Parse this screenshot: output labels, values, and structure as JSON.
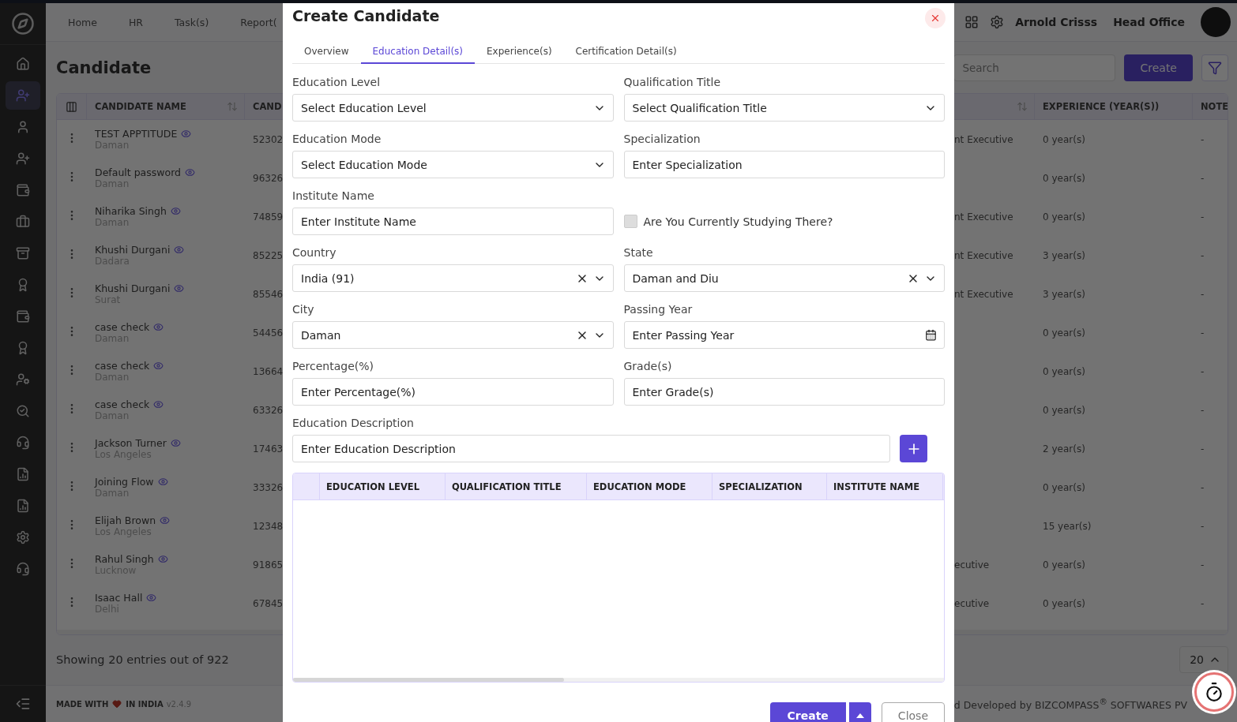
{
  "sidebar": {
    "items": [
      {
        "selected": false
      },
      {
        "selected": true
      },
      {
        "selected": false
      },
      {
        "selected": false
      },
      {
        "selected": false
      },
      {
        "selected": false
      },
      {
        "selected": false
      },
      {
        "selected": false
      },
      {
        "selected": false
      },
      {
        "selected": false
      },
      {
        "selected": false
      },
      {
        "selected": false
      },
      {
        "selected": false
      },
      {
        "selected": false
      },
      {
        "selected": false
      },
      {
        "selected": false
      },
      {
        "selected": false
      }
    ]
  },
  "top_nav": {
    "items": [
      "Home",
      "HR",
      "Task(s)",
      "Report("
    ],
    "user_name": "Arnold Crisss",
    "branch": "Head Office"
  },
  "page": {
    "title": "Candidate",
    "search": {
      "placeholder": "Search"
    },
    "create_button": "Create"
  },
  "table": {
    "columns": {
      "name": "CANDIDATE NAME",
      "column_2": "CAND",
      "experience": "EXPERIENCE (YEAR(S))",
      "note": "NOTE"
    },
    "rows": [
      {
        "name": "TEST APPTITUDE",
        "location": "Daman",
        "column_2": "52302",
        "column_4": "nt Executive",
        "experience": "0 year(s)",
        "note": "-"
      },
      {
        "name": "Default password",
        "location": "Daman",
        "column_2": "96326",
        "experience": "0 year(s)",
        "note": "-"
      },
      {
        "name": "Niharika Singh",
        "location": "Daman",
        "column_2": "74859",
        "column_4": "nt Executive",
        "experience": "0 year(s)",
        "note": "-"
      },
      {
        "name": "Khushi Durgani",
        "location": "Dadara",
        "column_2": "85225",
        "column_4": "nt Executive",
        "experience": "3 year(s)",
        "note": "-"
      },
      {
        "name": "Khushi Durgani",
        "location": "Surat",
        "column_2": "85546",
        "column_4": "nt Executive",
        "experience": "3 year(s)",
        "note": "-"
      },
      {
        "name": "case check",
        "location": "Daman",
        "column_2": "54456",
        "experience": "0 year(s)",
        "note": "-"
      },
      {
        "name": "case check",
        "location": "Daman",
        "column_2": "13664",
        "experience": "0 year(s)",
        "note": "-"
      },
      {
        "name": "case check",
        "location": "Daman",
        "column_2": "63326",
        "experience": "0 year(s)",
        "note": "-"
      },
      {
        "name": "Jackson Turner",
        "location": "Los Angeles",
        "column_2": "17463",
        "experience": "2 year(s)",
        "note": "-"
      },
      {
        "name": "Joining Flow",
        "location": "Daman",
        "column_2": "33326",
        "experience": "0 year(s)",
        "note": "-"
      },
      {
        "name": "Elijah Brown",
        "location": "Los Angeles",
        "column_2": "12348",
        "experience": "15 year(s)",
        "note": "-"
      },
      {
        "name": "Rahul Singh",
        "location": "Lucknow",
        "column_2": "91865",
        "column_4": "ecutive",
        "experience": "0 year(s)",
        "note": "-"
      },
      {
        "name": "Isaac Hall",
        "location": "Delhi",
        "column_2": "67845",
        "column_4": "ecutive",
        "experience": "0 year(s)",
        "note": "-"
      }
    ]
  },
  "footer": {
    "summary": "Showing 20 entries out of 922",
    "page_size": "20"
  },
  "bottom_bar": {
    "made_with": "MADE WITH",
    "in_india": "IN INDIA",
    "version": "v2.4.9",
    "developed_by": "d Developed by BIZCOMPASS$^{®}$ SOFTWARES PV"
  },
  "modal": {
    "title": "Create Candidate",
    "tabs": [
      {
        "label": "Overview",
        "selected": false
      },
      {
        "label": "Education Detail(s)",
        "selected": true
      },
      {
        "label": "Experience(s)",
        "selected": false
      },
      {
        "label": "Certification Detail(s)",
        "selected": false
      }
    ],
    "fields": [
      {
        "kind": "select",
        "label": "Education Level",
        "placeholder": "Select Education Level"
      },
      {
        "kind": "select",
        "label": "Qualification Title",
        "placeholder": "Select Qualification Title"
      },
      {
        "kind": "select",
        "label": "Education Mode",
        "placeholder": "Select Education Mode"
      },
      {
        "kind": "text",
        "label": "Specialization",
        "placeholder": "Enter Specialization"
      },
      {
        "kind": "text",
        "label": "Institute Name",
        "placeholder": "Enter Institute Name"
      },
      {
        "kind": "checkbox",
        "label": "Are You Currently Studying There?",
        "checked": false
      },
      {
        "kind": "select",
        "label": "Country",
        "value": "India (91)",
        "clearable": true
      },
      {
        "kind": "select",
        "label": "State",
        "value": "Daman and Diu",
        "clearable": true
      },
      {
        "kind": "select",
        "label": "City",
        "value": "Daman",
        "clearable": true
      },
      {
        "kind": "date",
        "label": "Passing Year",
        "placeholder": "Enter Passing Year"
      },
      {
        "kind": "text",
        "label": "Percentage(%)",
        "placeholder": "Enter Percentage(%)"
      },
      {
        "kind": "text",
        "label": "Grade(s)",
        "placeholder": "Enter Grade(s)"
      }
    ],
    "description": {
      "label": "Education Description",
      "placeholder": "Enter Education Description"
    },
    "education_table": {
      "columns": [
        "EDUCATION LEVEL",
        "QUALIFICATION TITLE",
        "EDUCATION MODE",
        "SPECIALIZATION",
        "INSTITUTE NAME"
      ]
    },
    "buttons": {
      "create": "Create",
      "close": "Close"
    }
  }
}
